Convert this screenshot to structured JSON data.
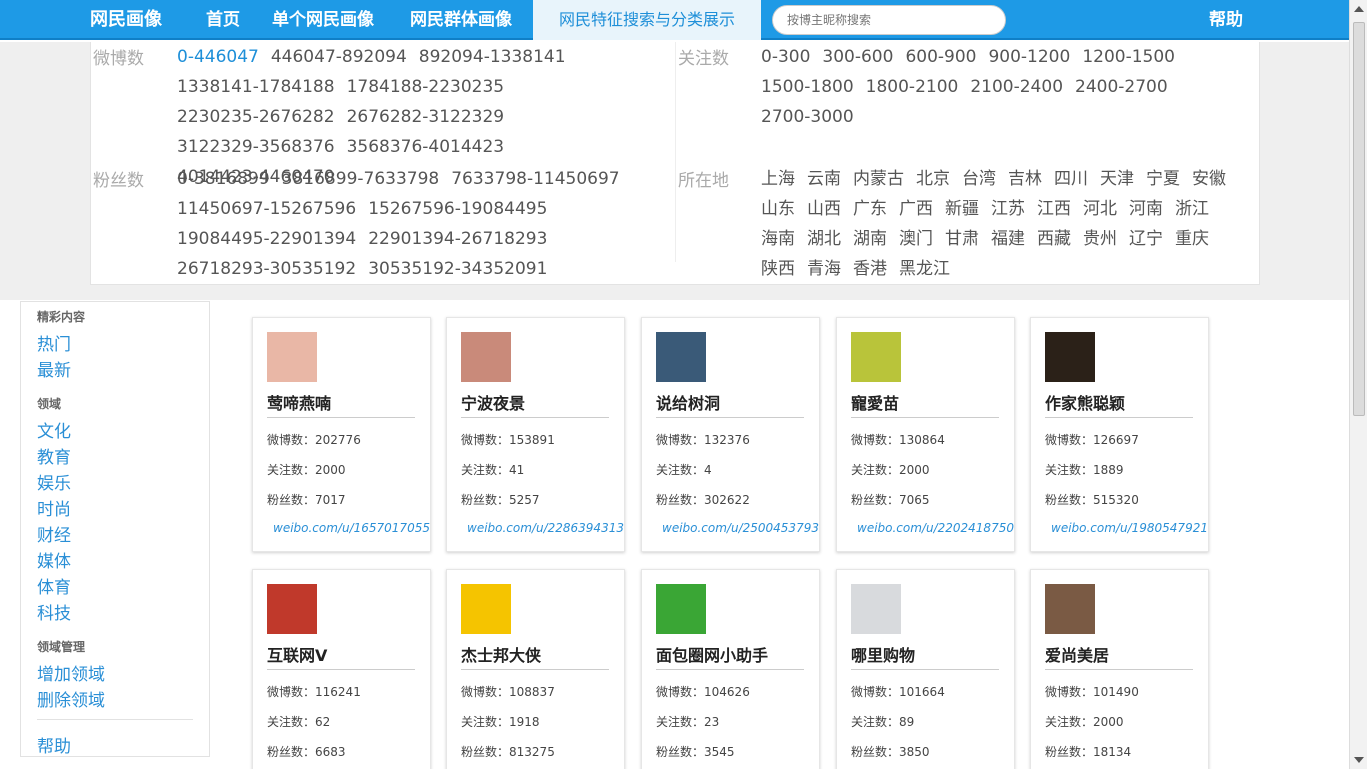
{
  "nav": {
    "brand": "网民画像",
    "home": "首页",
    "single": "单个网民画像",
    "group": "网民群体画像",
    "search_classify": "网民特征搜索与分类展示",
    "search_placeholder": "按博主昵称搜索",
    "help": "帮助"
  },
  "filters": {
    "weibo": {
      "label": "微博数",
      "options": [
        "0-446047",
        "446047-892094",
        "892094-1338141",
        "1338141-1784188",
        "1784188-2230235",
        "2230235-2676282",
        "2676282-3122329",
        "3122329-3568376",
        "3568376-4014423",
        "4014423-4460470"
      ]
    },
    "follow": {
      "label": "关注数",
      "options": [
        "0-300",
        "300-600",
        "600-900",
        "900-1200",
        "1200-1500",
        "1500-1800",
        "1800-2100",
        "2100-2400",
        "2400-2700",
        "2700-3000"
      ]
    },
    "fans": {
      "label": "粉丝数",
      "options": [
        "0-3816899",
        "3816899-7633798",
        "7633798-11450697",
        "11450697-15267596",
        "15267596-19084495",
        "19084495-22901394",
        "22901394-26718293",
        "26718293-30535192",
        "30535192-34352091"
      ]
    },
    "location": {
      "label": "所在地",
      "options": [
        "上海",
        "云南",
        "内蒙古",
        "北京",
        "台湾",
        "吉林",
        "四川",
        "天津",
        "宁夏",
        "安徽",
        "山东",
        "山西",
        "广东",
        "广西",
        "新疆",
        "江苏",
        "江西",
        "河北",
        "河南",
        "浙江",
        "海南",
        "湖北",
        "湖南",
        "澳门",
        "甘肃",
        "福建",
        "西藏",
        "贵州",
        "辽宁",
        "重庆",
        "陕西",
        "青海",
        "香港",
        "黑龙江"
      ]
    }
  },
  "sidebar": {
    "featured_head": "精彩内容",
    "featured": [
      "热门",
      "最新"
    ],
    "domain_head": "领域",
    "domains": [
      "文化",
      "教育",
      "娱乐",
      "时尚",
      "财经",
      "媒体",
      "体育",
      "科技"
    ],
    "manage_head": "领域管理",
    "manage": [
      "增加领域",
      "删除领域"
    ],
    "help": "帮助"
  },
  "stat_labels": {
    "weibo": "微博数：",
    "follow": "关注数：",
    "fans": "粉丝数："
  },
  "users": [
    {
      "name": "莺啼燕喃",
      "weibo": "202776",
      "follow": "2000",
      "fans": "7017",
      "url": "weibo.com/u/1657017055",
      "avatar_color": "#e9b7a6"
    },
    {
      "name": "宁波夜景",
      "weibo": "153891",
      "follow": "41",
      "fans": "5257",
      "url": "weibo.com/u/2286394313",
      "avatar_color": "#c98a7a"
    },
    {
      "name": "说给树洞",
      "weibo": "132376",
      "follow": "4",
      "fans": "302622",
      "url": "weibo.com/u/2500453793",
      "avatar_color": "#3a5a78"
    },
    {
      "name": "寵愛苗",
      "weibo": "130864",
      "follow": "2000",
      "fans": "7065",
      "url": "weibo.com/u/2202418750",
      "avatar_color": "#b9c43a"
    },
    {
      "name": "作家熊聪颖",
      "weibo": "126697",
      "follow": "1889",
      "fans": "515320",
      "url": "weibo.com/u/1980547921",
      "avatar_color": "#2b2118"
    },
    {
      "name": "互联网V",
      "weibo": "116241",
      "follow": "62",
      "fans": "6683",
      "url": "",
      "avatar_color": "#c0392b"
    },
    {
      "name": "杰士邦大侠",
      "weibo": "108837",
      "follow": "1918",
      "fans": "813275",
      "url": "",
      "avatar_color": "#f5c400"
    },
    {
      "name": "面包圈网小助手",
      "weibo": "104626",
      "follow": "23",
      "fans": "3545",
      "url": "",
      "avatar_color": "#3aa635"
    },
    {
      "name": "哪里购物",
      "weibo": "101664",
      "follow": "89",
      "fans": "3850",
      "url": "",
      "avatar_color": "#d8dadd"
    },
    {
      "name": "爱尚美居",
      "weibo": "101490",
      "follow": "2000",
      "fans": "18134",
      "url": "",
      "avatar_color": "#7a5a44"
    }
  ]
}
